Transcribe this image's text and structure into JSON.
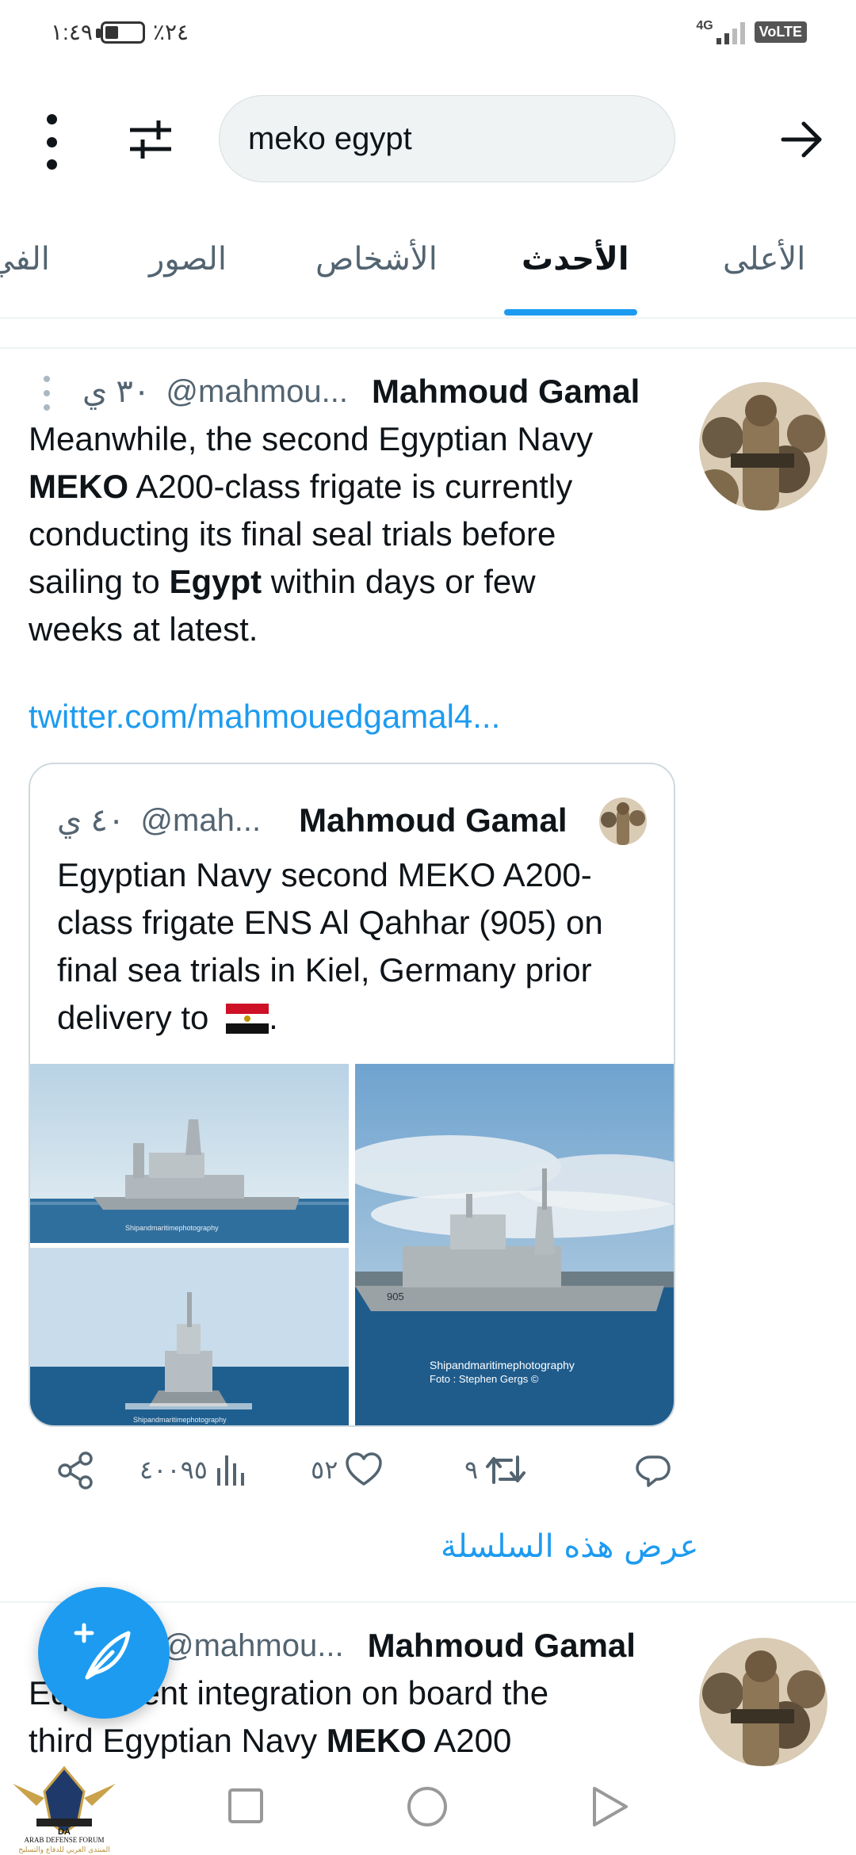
{
  "status_bar": {
    "time": "١:٤٩",
    "battery_percent": "٪٢٤",
    "network_label": "4G",
    "volte_label": "VoLTE",
    "signal_level": 0.5,
    "battery_level": 0.24
  },
  "search": {
    "query": "meko egypt"
  },
  "tabs": [
    {
      "label": "الأعلى",
      "active": false
    },
    {
      "label": "الأحدث",
      "active": true
    },
    {
      "label": "الأشخاص",
      "active": false
    },
    {
      "label": "الصور",
      "active": false
    },
    {
      "label": "الفي",
      "active": false
    }
  ],
  "tweet1": {
    "name": "Mahmoud Gamal",
    "handle": "@mahmou...",
    "time": "٣٠ ي",
    "text_line1": "Meanwhile, the second Egyptian Navy",
    "text_bold_meko": "MEKO",
    "text_line2_rest": " A200-class frigate is currently",
    "text_line3": "conducting its final seal trials before",
    "text_line4_pre": "sailing to ",
    "text_bold_egypt": "Egypt",
    "text_line4_post": " within days or few",
    "text_line5": "weeks at latest.",
    "link": "twitter.com/mahmouedgamal4...",
    "quote": {
      "name": "Mahmoud Gamal",
      "handle": "@mah...",
      "time": "٤٠ ي",
      "text": "Egyptian Navy second MEKO A200-class frigate ENS Al Qahhar (905) on final sea trials in Kiel, Germany prior delivery to",
      "text_end": ".",
      "image_caption_1": "Shipandmaritimephotography",
      "image_caption_2": "Foto : Stephen Gergs ©",
      "hull_number": "905"
    },
    "actions": {
      "retweets": "٩",
      "likes": "٥٢",
      "views": "٤٠٠٩٥"
    },
    "show_thread": "عرض هذه السلسلة"
  },
  "tweet2": {
    "name": "Mahmoud Gamal",
    "handle": "@mahmou...",
    "text_line1": "Equipment integration on board the",
    "text_line2_pre": "third Egyptian Navy ",
    "text_bold_meko": "MEKO",
    "text_line2_post": " A200"
  },
  "watermark": {
    "short": "DA",
    "line1": "ARAB DEFENSE FORUM",
    "line2": "المنتدى العربي للدفاع والتسليح"
  },
  "colors": {
    "accent": "#1d9bf0",
    "text": "#0f1419",
    "secondary": "#536471"
  }
}
